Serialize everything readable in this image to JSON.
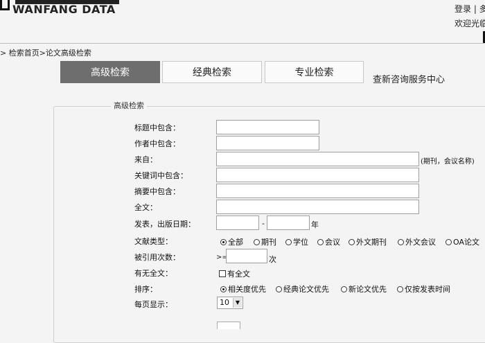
{
  "header": {
    "logo_text": "WANFANG DATA",
    "top_links": "登录 | 多",
    "welcome": "欢迎光临"
  },
  "breadcrumb": "> 检索首页>论文高级检索",
  "tabs": [
    {
      "label": "高级检索",
      "active": true
    },
    {
      "label": "经典检索",
      "active": false
    },
    {
      "label": "专业检索",
      "active": false
    }
  ],
  "consult_link": "查新咨询服务中心",
  "form": {
    "legend": "高级检索",
    "title_label": "标题中包含：",
    "author_label": "作者中包含：",
    "source_label": "来自：",
    "source_note": "(期刊，会议名称)",
    "keyword_label": "关键词中包含：",
    "abstract_label": "摘要中包含：",
    "fulltext_label": "全文：",
    "date_label": "发表，出版日期：",
    "date_sep": "-",
    "date_suffix": "年",
    "doctype_label": "文献类型：",
    "doctype_options": [
      "全部",
      "期刊",
      "学位",
      "会议",
      "外文期刊",
      "外文会议",
      "OA论文"
    ],
    "doctype_selected": 0,
    "cited_label": "被引用次数：",
    "cited_prefix": ">=",
    "cited_suffix": "次",
    "hasfull_label": "有无全文：",
    "hasfull_option": "有全文",
    "sort_label": "排序：",
    "sort_options": [
      "相关度优先",
      "经典论文优先",
      "新论文优先",
      "仅按发表时间"
    ],
    "sort_selected": 0,
    "perpage_label": "每页显示：",
    "perpage_value": "10"
  },
  "icons": {
    "dropdown": "chevron-down-icon",
    "radio": "radio-icon",
    "checkbox": "checkbox-icon"
  },
  "colors": {
    "active_tab": "#6e6e6e",
    "background": "#f4f4f4"
  }
}
